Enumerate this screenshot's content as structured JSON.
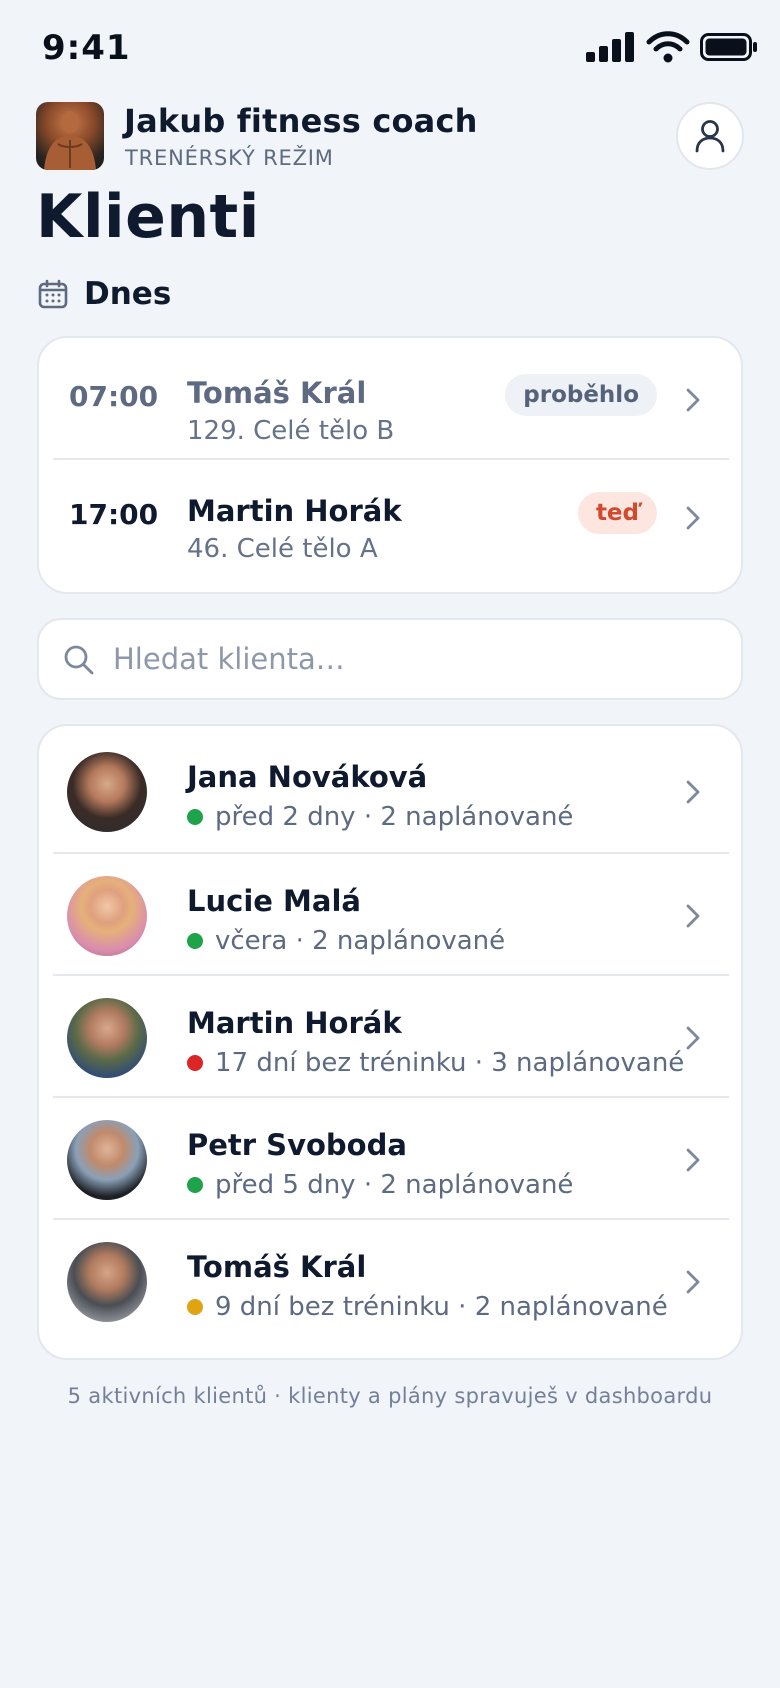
{
  "status_bar": {
    "time": "9:41"
  },
  "header": {
    "app_name": "Jakub fitness coach",
    "mode": "TRENÉRSKÝ REŽIM"
  },
  "page_title": "Klienti",
  "today": {
    "label": "Dnes",
    "appointments": [
      {
        "time": "07:00",
        "client": "Tomáš Král",
        "workout": "129. Celé tělo B",
        "badge": "proběhlo",
        "badge_kind": "done"
      },
      {
        "time": "17:00",
        "client": "Martin Horák",
        "workout": "46. Celé tělo A",
        "badge": "teď",
        "badge_kind": "now"
      }
    ]
  },
  "search": {
    "placeholder": "Hledat klienta…"
  },
  "clients": [
    {
      "name": "Jana Nováková",
      "status": "před 2 dny · 2 naplánované",
      "status_color": "#1fa34a"
    },
    {
      "name": "Lucie Malá",
      "status": "včera · 2 naplánované",
      "status_color": "#1fa34a"
    },
    {
      "name": "Martin Horák",
      "status": "17 dní bez tréninku · 3 naplánované",
      "status_color": "#dc2626"
    },
    {
      "name": "Petr Svoboda",
      "status": "před 5 dny · 2 naplánované",
      "status_color": "#1fa34a"
    },
    {
      "name": "Tomáš Král",
      "status": "9 dní bez tréninku · 2 naplánované",
      "status_color": "#e0a412"
    }
  ],
  "footer": "5 aktivních klientů · klienty a plány spravuješ v dashboardu",
  "colors": {
    "background": "#f1f4f8",
    "text": "#0f1a2e",
    "muted": "#5d6a82",
    "now_badge": "#d2492e"
  },
  "icons": [
    "signal-icon",
    "wifi-icon",
    "battery-icon",
    "user-icon",
    "calendar-icon",
    "search-icon",
    "chevron-right-icon"
  ]
}
